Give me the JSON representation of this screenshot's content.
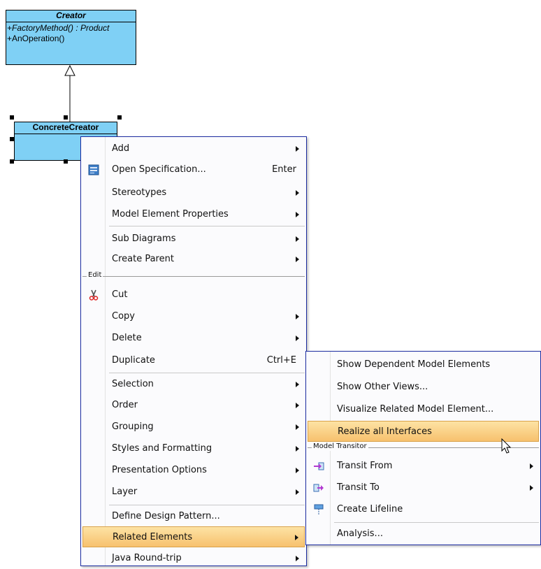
{
  "diagram": {
    "creator": {
      "name": "Creator",
      "operations": [
        "+FactoryMethod() : Product",
        "+AnOperation()"
      ]
    },
    "concrete_creator": {
      "name": "ConcreteCreator"
    },
    "colors": {
      "class_fill": "#7fd0f5",
      "highlight": "#f7c16e",
      "menu_border": "#1b2ba0"
    }
  },
  "context_menu": {
    "items": [
      {
        "label": "Add",
        "submenu": true
      },
      {
        "label": "Open Specification...",
        "shortcut": "Enter",
        "icon": "specification-icon"
      },
      {
        "label": "Stereotypes",
        "submenu": true
      },
      {
        "label": "Model Element Properties",
        "submenu": true
      },
      {
        "label": "Sub Diagrams",
        "submenu": true
      },
      {
        "label": "Create Parent",
        "submenu": true
      },
      {
        "label": "Cut",
        "icon": "scissors-icon"
      },
      {
        "label": "Copy",
        "submenu": true
      },
      {
        "label": "Delete",
        "submenu": true
      },
      {
        "label": "Duplicate",
        "shortcut": "Ctrl+E"
      },
      {
        "label": "Selection",
        "submenu": true
      },
      {
        "label": "Order",
        "submenu": true
      },
      {
        "label": "Grouping",
        "submenu": true
      },
      {
        "label": "Styles and Formatting",
        "submenu": true
      },
      {
        "label": "Presentation Options",
        "submenu": true
      },
      {
        "label": "Layer",
        "submenu": true
      },
      {
        "label": "Define Design Pattern..."
      },
      {
        "label": "Related Elements",
        "submenu": true,
        "highlighted": true
      },
      {
        "label": "Java Round-trip",
        "submenu": true
      }
    ],
    "group_edit": "Edit"
  },
  "submenu": {
    "items": [
      {
        "label": "Show Dependent Model Elements"
      },
      {
        "label": "Show Other Views..."
      },
      {
        "label": "Visualize Related Model Element..."
      },
      {
        "label": "Realize all Interfaces",
        "highlighted": true
      },
      {
        "label": "Transit From",
        "submenu": true,
        "icon": "transit-from-icon"
      },
      {
        "label": "Transit To",
        "submenu": true,
        "icon": "transit-to-icon"
      },
      {
        "label": "Create Lifeline",
        "icon": "lifeline-icon"
      },
      {
        "label": "Analysis..."
      }
    ],
    "group_model_transitor": "Model Transitor"
  }
}
